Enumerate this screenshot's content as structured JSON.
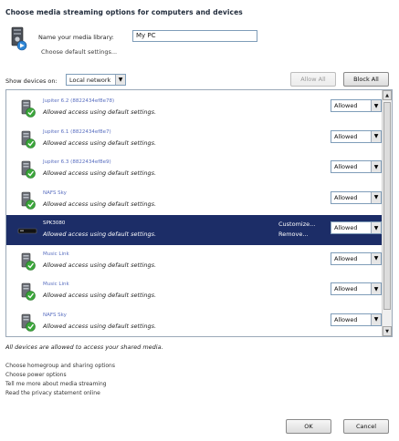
{
  "header": {
    "title": "Choose media streaming options for computers and devices"
  },
  "library": {
    "name_label": "Name your media library:",
    "name_value": "My PC",
    "default_settings_link": "Choose default settings..."
  },
  "filter": {
    "show_label": "Show devices on:",
    "selected": "Local network",
    "allow_all": "Allow All",
    "block_all": "Block All"
  },
  "devices": [
    {
      "name": "Jupiter 6.2 (8822434ef8e78)",
      "status": "Allowed access using default settings.",
      "permission": "Allowed",
      "selected": false
    },
    {
      "name": "Jupiter 6.1 (8822434ef8e7)",
      "status": "Allowed access using default settings.",
      "permission": "Allowed",
      "selected": false
    },
    {
      "name": "Jupiter 6.3 (8822434ef8e9)",
      "status": "Allowed access using default settings.",
      "permission": "Allowed",
      "selected": false
    },
    {
      "name": "NAFS Sky",
      "status": "Allowed access using default settings.",
      "permission": "Allowed",
      "selected": false
    },
    {
      "name": "SPK3080",
      "status": "Allowed access using default settings.",
      "permission": "Allowed",
      "selected": true,
      "customize": "Customize...",
      "remove": "Remove..."
    },
    {
      "name": "Music Link",
      "status": "Allowed access using default settings.",
      "permission": "Allowed",
      "selected": false
    },
    {
      "name": "Music Link",
      "status": "Allowed access using default settings.",
      "permission": "Allowed",
      "selected": false
    },
    {
      "name": "NAFS Sky",
      "status": "Allowed access using default settings.",
      "permission": "Allowed",
      "selected": false
    }
  ],
  "footer": {
    "note": "All devices are allowed to access your shared media.",
    "links": [
      "Choose homegroup and sharing options",
      "Choose power options",
      "Tell me more about media streaming",
      "Read the privacy statement online"
    ],
    "ok": "OK",
    "cancel": "Cancel"
  }
}
